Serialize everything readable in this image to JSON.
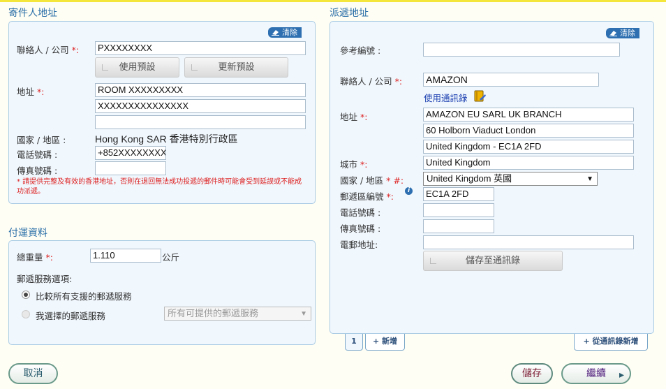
{
  "sender": {
    "title": "寄件人地址",
    "clear_label": "清除",
    "contact_label": "聯絡人 / 公司",
    "contact_value": "PXXXXXXXX",
    "use_default_label": "使用預設",
    "update_default_label": "更新預設",
    "address_label": "地址",
    "address_lines": [
      "ROOM XXXXXXXXX",
      "XXXXXXXXXXXXXXX",
      ""
    ],
    "country_label": "國家 / 地區 :",
    "country_value": "Hong Kong SAR 香港特別行政區",
    "phone_label": "電話號碼 :",
    "phone_value": "+852XXXXXXXX",
    "fax_label": "傳真號碼 :",
    "fax_value": "",
    "note": "* 請提供完整及有效的香港地址，否則在退回無法成功投遞的郵件時可能會受到延誤或不能成功派遞。"
  },
  "delivery": {
    "title": "派遞地址",
    "clear_label": "清除",
    "ref_label": "參考編號 :",
    "ref_value": "",
    "contact_label": "聯絡人 / 公司",
    "contact_value": "AMAZON",
    "address_book_link": "使用通訊錄",
    "address_label": "地址",
    "address_lines": [
      "AMAZON EU SARL UK BRANCH",
      "60 Holborn Viaduct London",
      "United Kingdom - EC1A 2FD"
    ],
    "city_label": "城市",
    "city_value": "United Kingdom",
    "country_label": "國家 / 地區",
    "country_value": "United Kingdom 英國",
    "postcode_label": "郵遞區編號",
    "postcode_value": "EC1A 2FD",
    "phone_label": "電話號碼 :",
    "fax_label": "傳真號碼 :",
    "email_label": "電郵地址:",
    "save_to_book_label": "儲存至通訊錄",
    "tab_current": "1",
    "tab_add": "+ 新增",
    "add_from_book": "+ 從通訊錄新增"
  },
  "shipping": {
    "title": "付運資料",
    "weight_label": "總重量",
    "weight_value": "1.110",
    "weight_unit": "公斤",
    "service_label": "郵遞服務選項:",
    "option_compare": "比較所有支援的郵遞服務",
    "option_choose": "我選擇的郵遞服務",
    "service_select": "所有可提供的郵遞服務"
  },
  "footer": {
    "cancel_label": "取消",
    "save_label": "儲存",
    "continue_label": "繼續"
  },
  "symbols": {
    "required": "*:",
    "required_star": "*",
    "country_required": "* #:",
    "colon": ":"
  },
  "colors": {
    "accent": "#2a6fa8",
    "panel_bg": "#f0f7fd",
    "required": "#d22222",
    "top_bar": "#f5e63c"
  }
}
